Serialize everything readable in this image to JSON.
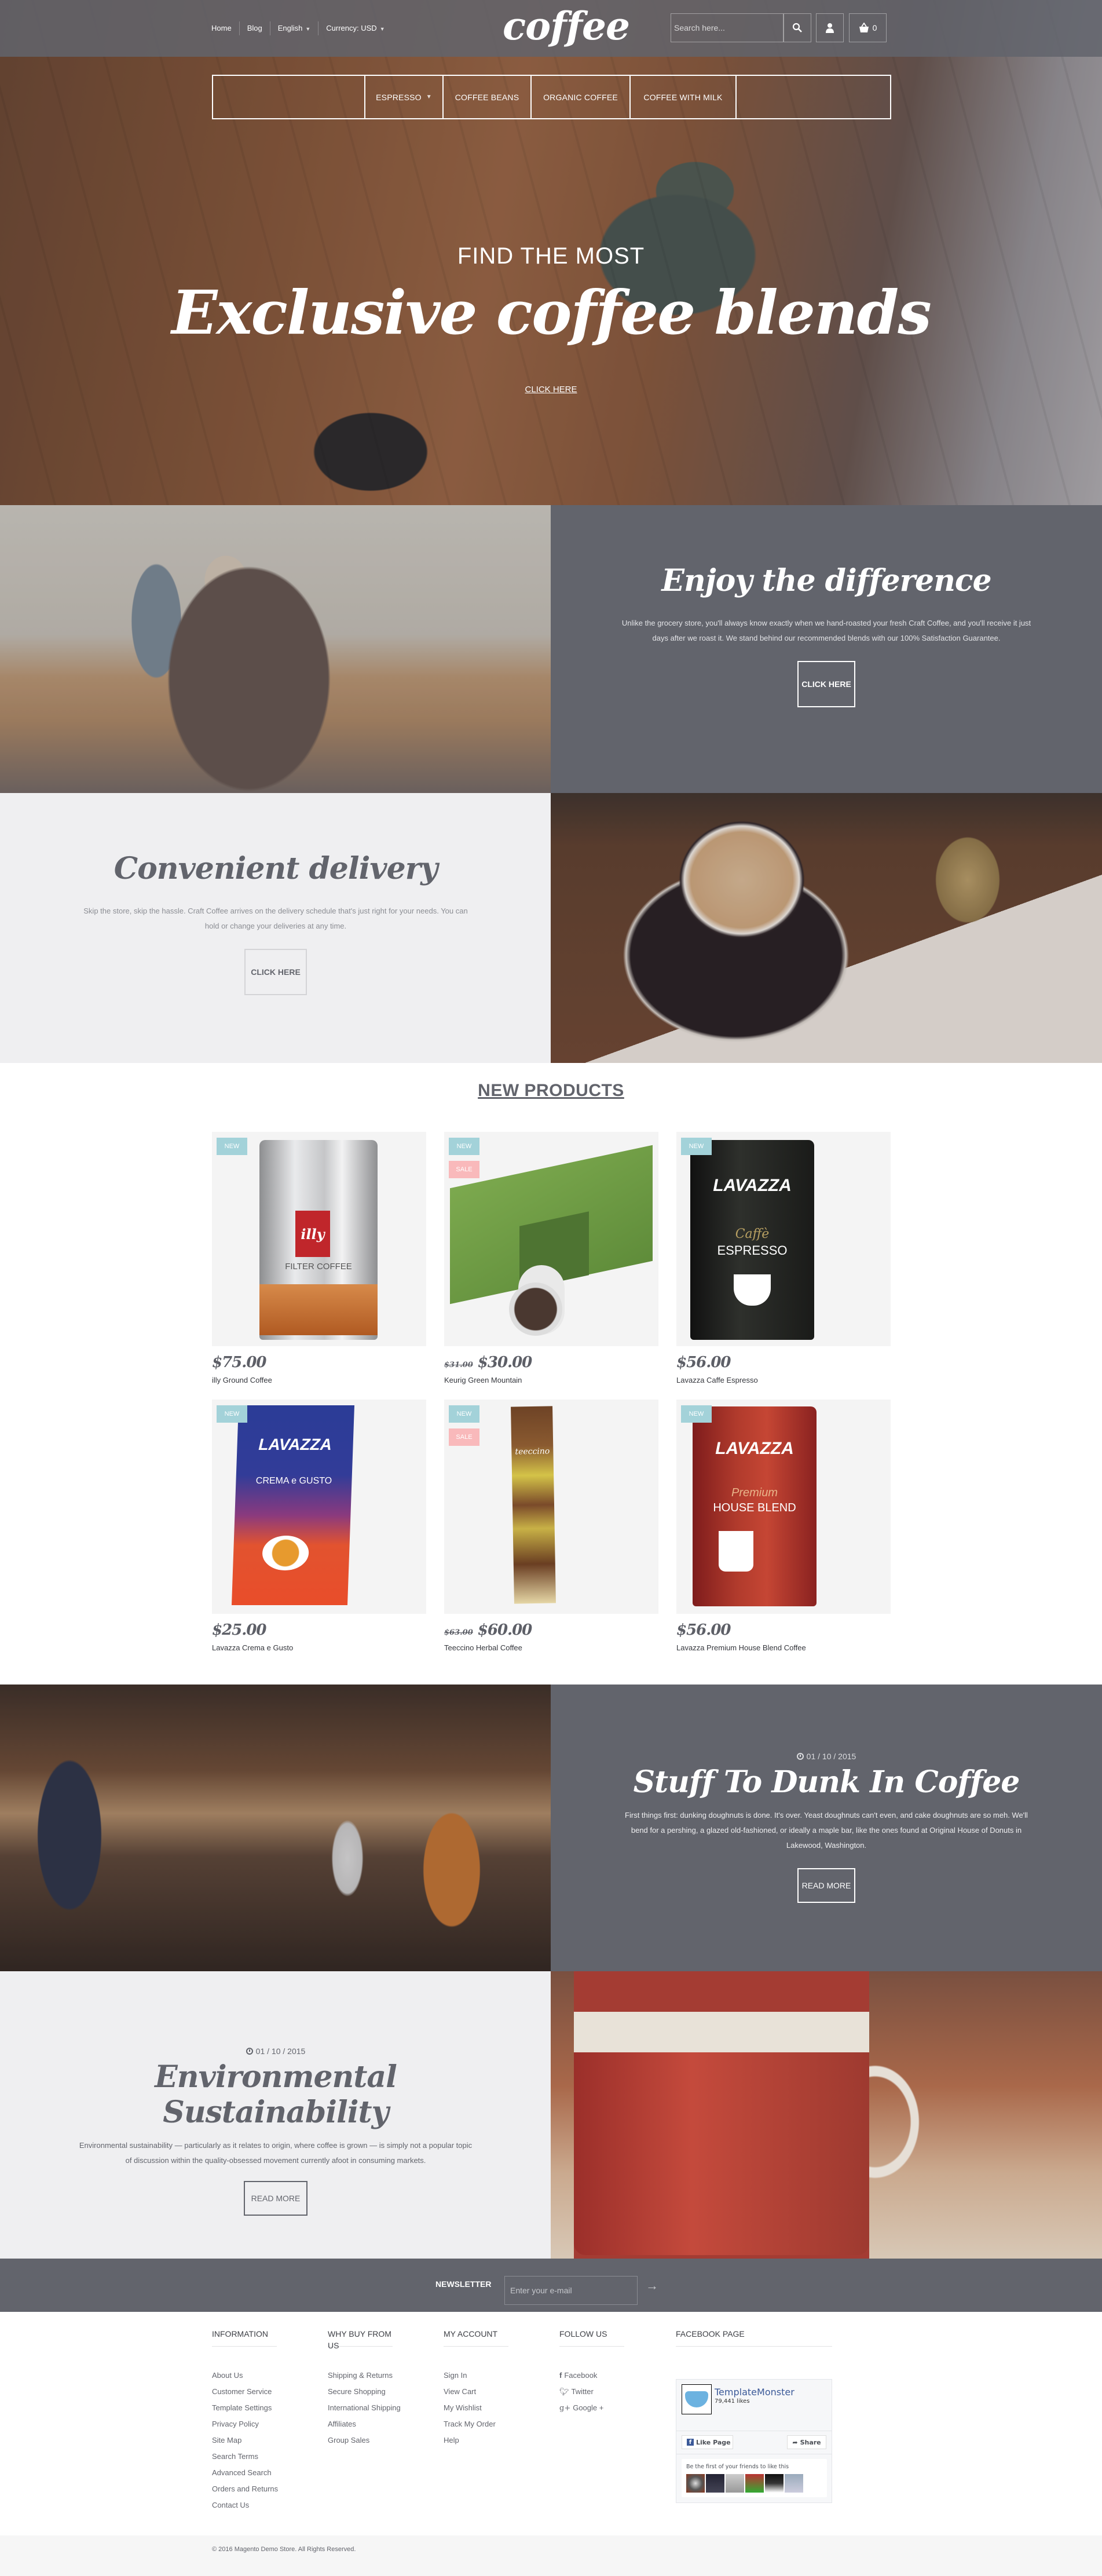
{
  "header": {
    "nav": [
      "Home",
      "Blog",
      "English",
      "Currency: USD"
    ],
    "logo": "coffee",
    "search_placeholder": "Search here...",
    "cart_count": "0"
  },
  "main_nav": [
    "Espresso",
    "Coffee beans",
    "Organic coffee",
    "Coffee with milk"
  ],
  "hero": {
    "subtitle": "FIND THE MOST",
    "title": "Exclusive coffee blends",
    "link": "CLICK HERE"
  },
  "enjoy": {
    "title": "Enjoy the difference",
    "body": "Unlike the grocery store, you'll always know exactly when we hand-roasted your fresh Craft Coffee, and you'll receive it just days after we roast it. We stand behind our recommended blends with our 100% Satisfaction Guarantee.",
    "button": "CLICK HERE"
  },
  "delivery": {
    "title": "Convenient delivery",
    "body": "Skip the store, skip the hassle. Craft Coffee arrives on the delivery schedule that's just right for your needs. You can hold or change your deliveries at any time.",
    "button": "CLICK HERE"
  },
  "new_products": {
    "title": "NEW PRODUCTS",
    "badges": {
      "new": "NEW",
      "sale": "SALE"
    },
    "items": [
      {
        "name": "illy Ground Coffee",
        "price": "$75.00",
        "old_price": "",
        "new": true,
        "sale": false
      },
      {
        "name": "Keurig Green Mountain",
        "price": "$30.00",
        "old_price": "$31.00",
        "new": true,
        "sale": true
      },
      {
        "name": "Lavazza Caffe Espresso",
        "price": "$56.00",
        "old_price": "",
        "new": true,
        "sale": false
      },
      {
        "name": "Lavazza Crema e Gusto",
        "price": "$25.00",
        "old_price": "",
        "new": true,
        "sale": false
      },
      {
        "name": "Teeccino Herbal Coffee",
        "price": "$60.00",
        "old_price": "$63.00",
        "new": true,
        "sale": true
      },
      {
        "name": "Lavazza Premium House Blend Coffee",
        "price": "$56.00",
        "old_price": "",
        "new": true,
        "sale": false
      }
    ]
  },
  "posts": [
    {
      "date": "01 / 10 / 2015",
      "title": "Stuff To Dunk In Coffee",
      "body": "First things first: dunking doughnuts is done. It's over. Yeast doughnuts can't even, and cake doughnuts are so meh. We'll bend for a pershing, a glazed old-fashioned, or ideally a maple bar, like the ones found at Original House of Donuts in Lakewood, Washington.",
      "button": "READ MORE"
    },
    {
      "date": "01 / 10 / 2015",
      "title": "Environmental Sustainability",
      "body": "Environmental sustainability — particularly as it relates to origin, where coffee is grown — is simply not a popular topic of discussion within the quality-obsessed movement currently afoot in consuming markets.",
      "button": "READ MORE"
    }
  ],
  "newsletter": {
    "label": "NEWSLETTER",
    "placeholder": "Enter your e-mail"
  },
  "footer": {
    "columns": [
      {
        "title": "INFORMATION",
        "links": [
          "About Us",
          "Customer Service",
          "Template Settings",
          "Privacy Policy",
          "Site Map",
          "Search Terms",
          "Advanced Search",
          "Orders and Returns",
          "Contact Us"
        ]
      },
      {
        "title": "WHY BUY FROM US",
        "links": [
          "Shipping & Returns",
          "Secure Shopping",
          "International Shipping",
          "Affiliates",
          "Group Sales"
        ]
      },
      {
        "title": "MY ACCOUNT",
        "links": [
          "Sign In",
          "View Cart",
          "My Wishlist",
          "Track My Order",
          "Help"
        ]
      },
      {
        "title": "FOLLOW US",
        "links": [
          "Facebook",
          "Twitter",
          "Google +"
        ]
      }
    ],
    "facebook": {
      "title": "FACEBOOK PAGE",
      "page_name": "TemplateMonster",
      "likes": "79,441 likes",
      "like_button": "Like Page",
      "share_button": "Share",
      "friends_text": "Be the first of your friends to like this"
    },
    "copyright": "© 2016 Magento Demo Store. All Rights Reserved."
  }
}
